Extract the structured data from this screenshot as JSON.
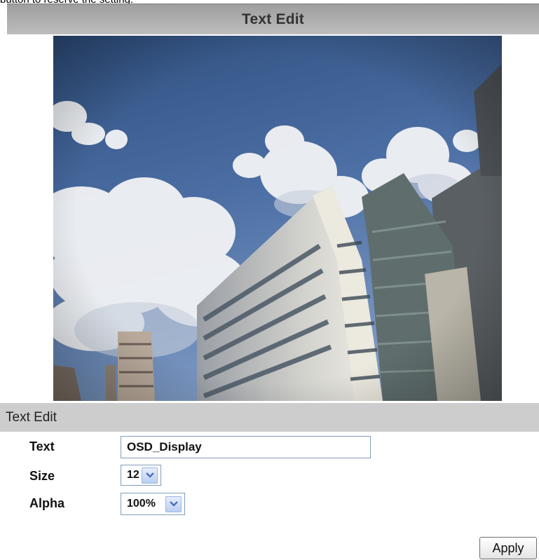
{
  "page": {
    "top_text": "button to reserve the setting."
  },
  "header": {
    "title": "Text Edit"
  },
  "section": {
    "title": "Text Edit"
  },
  "form": {
    "text_label": "Text",
    "text_value": "OSD_Display",
    "size_label": "Size",
    "size_value": "12",
    "alpha_label": "Alpha",
    "alpha_value": "100%"
  },
  "actions": {
    "apply_label": "Apply"
  },
  "icons": {
    "dropdown": "chevron-down-icon"
  },
  "colors": {
    "header_bar": "#aeaeae",
    "section_bar": "#cdcdcd",
    "input_border": "#7f9db9",
    "dropdown_arrow": "#4d6fb8"
  }
}
